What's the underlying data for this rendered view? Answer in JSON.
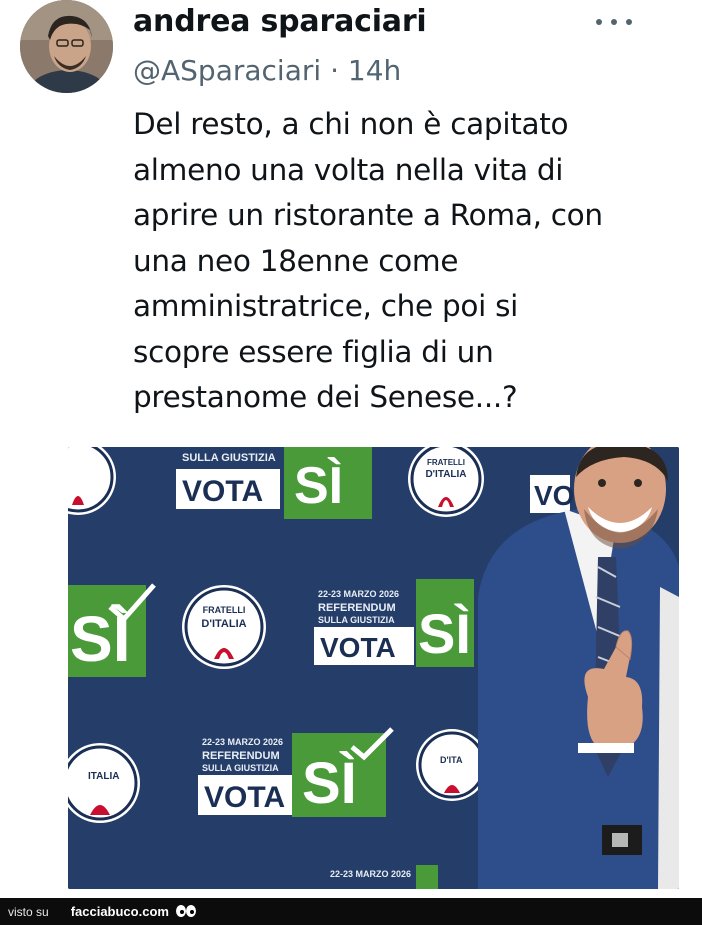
{
  "author": {
    "display_name": "andrea sparaciari",
    "handle": "@ASparaciari",
    "separator": "·",
    "time": "14h"
  },
  "tweet": {
    "lines": [
      "Del resto, a chi non è capitato",
      "almeno una volta nella vita di",
      "aprire un ristorante a Roma, con",
      "una neo 18enne come",
      "amministratrice, che poi si",
      "scopre essere figlia di un",
      "prestanome dei Senese...?"
    ]
  },
  "media": {
    "backdrop_texts": {
      "vota": "VOTA",
      "si": "SÌ",
      "referendum": "REFERENDUM",
      "sulla_giustizia": "SULLA GIUSTIZIA",
      "date": "22-23 MARZO 2026",
      "fratelli": "FRATELLI",
      "ditalia": "D'ITALIA"
    }
  },
  "footer": {
    "visto_su": "visto su",
    "site": "facciabuco.com"
  },
  "colors": {
    "backdrop_blue": "#223a63",
    "green": "#4a9a3a",
    "handle_gray": "#536471",
    "text": "#0f1419"
  },
  "icons": {
    "more": "more-horizontal-icon",
    "eyes": "eyes-icon",
    "logo": "fratelli-ditalia-logo"
  }
}
